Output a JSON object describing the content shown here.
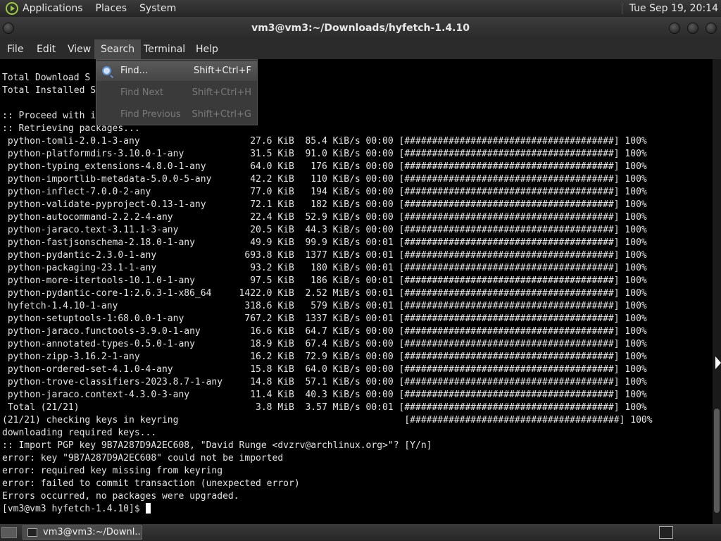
{
  "topbar": {
    "menus": [
      "Applications",
      "Places",
      "System"
    ],
    "clock": "Tue Sep 19, 20:14"
  },
  "window": {
    "title": "vm3@vm3:~/Downloads/hyfetch-1.4.10"
  },
  "menubar": {
    "items": [
      "File",
      "Edit",
      "View",
      "Search",
      "Terminal",
      "Help"
    ],
    "active": "Search"
  },
  "search_menu": {
    "items": [
      {
        "label": "Find...",
        "shortcut": "Shift+Ctrl+F",
        "enabled": true
      },
      {
        "label": "Find Next",
        "shortcut": "Shift+Ctrl+H",
        "enabled": false
      },
      {
        "label": "Find Previous",
        "shortcut": "Shift+Ctrl+G",
        "enabled": false
      }
    ]
  },
  "terminal": {
    "lines": [
      "",
      "Total Download S",
      "Total Installed S",
      "",
      ":: Proceed with i",
      ":: Retrieving packages...",
      " python-tomli-2.0.1-3-any                    27.6 KiB  85.4 KiB/s 00:00 [######################################] 100%",
      " python-platformdirs-3.10.0-1-any            31.5 KiB  91.0 KiB/s 00:00 [######################################] 100%",
      " python-typing_extensions-4.8.0-1-any        64.0 KiB   176 KiB/s 00:00 [######################################] 100%",
      " python-importlib-metadata-5.0.0-5-any       42.2 KiB   110 KiB/s 00:00 [######################################] 100%",
      " python-inflect-7.0.0-2-any                  77.0 KiB   194 KiB/s 00:00 [######################################] 100%",
      " python-validate-pyproject-0.13-1-any        72.1 KiB   182 KiB/s 00:00 [######################################] 100%",
      " python-autocommand-2.2.2-4-any              22.4 KiB  52.9 KiB/s 00:00 [######################################] 100%",
      " python-jaraco.text-3.11.1-3-any             20.5 KiB  44.3 KiB/s 00:00 [######################################] 100%",
      " python-fastjsonschema-2.18.0-1-any          49.9 KiB  99.9 KiB/s 00:01 [######################################] 100%",
      " python-pydantic-2.3.0-1-any                693.8 KiB  1377 KiB/s 00:01 [######################################] 100%",
      " python-packaging-23.1-1-any                 93.2 KiB   180 KiB/s 00:01 [######################################] 100%",
      " python-more-itertools-10.1.0-1-any          97.5 KiB   186 KiB/s 00:01 [######################################] 100%",
      " python-pydantic-core-1:2.6.3-1-x86_64     1422.0 KiB  2.52 MiB/s 00:01 [######################################] 100%",
      " hyfetch-1.4.10-1-any                       318.6 KiB   579 KiB/s 00:01 [######################################] 100%",
      " python-setuptools-1:68.0.0-1-any           767.2 KiB  1337 KiB/s 00:01 [######################################] 100%",
      " python-jaraco.functools-3.9.0-1-any         16.6 KiB  64.7 KiB/s 00:00 [######################################] 100%",
      " python-annotated-types-0.5.0-1-any          18.9 KiB  67.4 KiB/s 00:00 [######################################] 100%",
      " python-zipp-3.16.2-1-any                    16.2 KiB  72.9 KiB/s 00:00 [######################################] 100%",
      " python-ordered-set-4.1.0-4-any              15.8 KiB  64.0 KiB/s 00:00 [######################################] 100%",
      " python-trove-classifiers-2023.8.7-1-any     14.8 KiB  57.1 KiB/s 00:00 [######################################] 100%",
      " python-jaraco.context-4.3.0-3-any           11.4 KiB  40.3 KiB/s 00:00 [######################################] 100%",
      " Total (21/21)                                3.8 MiB  3.57 MiB/s 00:01 [######################################] 100%",
      "(21/21) checking keys in keyring                                         [######################################] 100%",
      "downloading required keys...",
      ":: Import PGP key 9B7A287D9A2EC608, \"David Runge <dvzrv@archlinux.org>\"? [Y/n]",
      "error: key \"9B7A287D9A2EC608\" could not be imported",
      "error: required key missing from keyring",
      "error: failed to commit transaction (unexpected error)",
      "Errors occurred, no packages were upgraded."
    ],
    "prompt": "[vm3@vm3 hyfetch-1.4.10]$ "
  },
  "taskbar": {
    "window_button": "vm3@vm3:~/Downl..."
  }
}
